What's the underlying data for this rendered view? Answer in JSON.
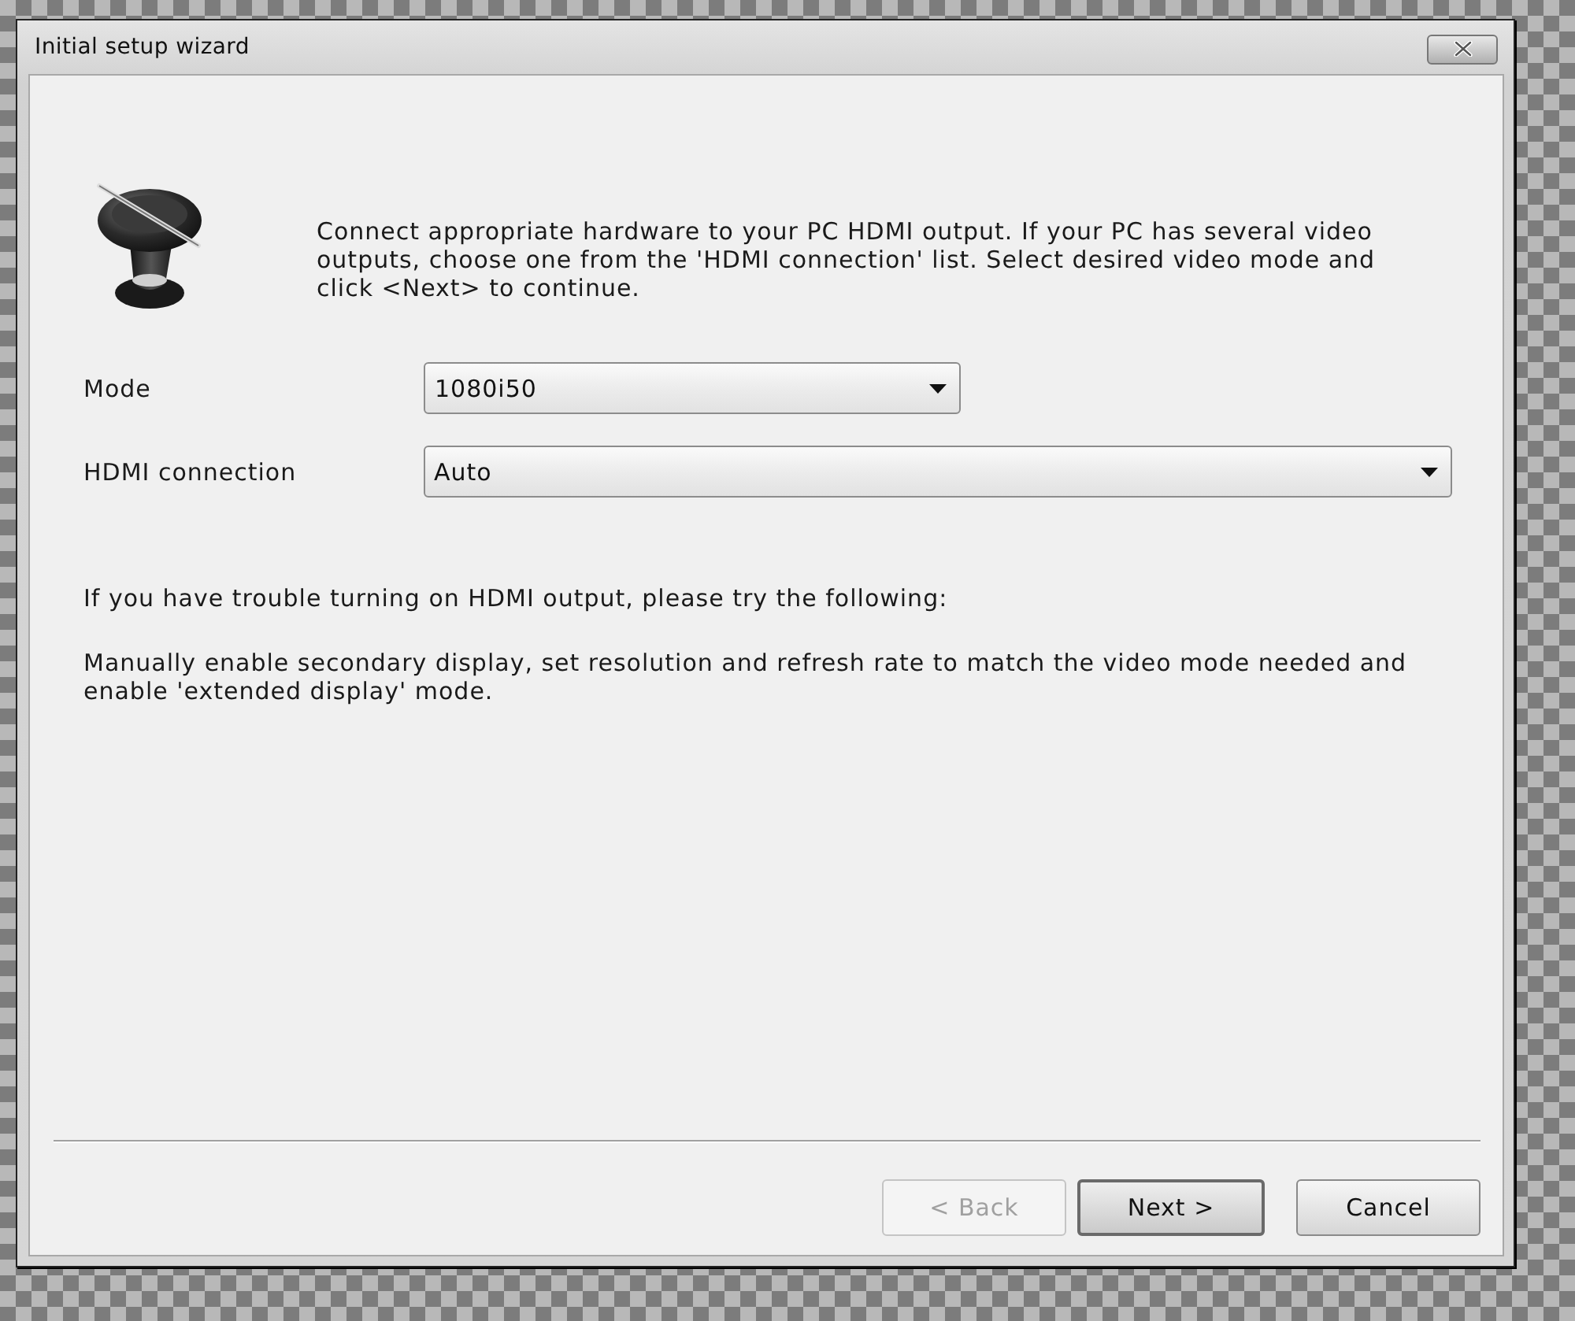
{
  "window": {
    "title": "Initial setup wizard"
  },
  "intro": {
    "text": "Connect appropriate hardware to your PC HDMI output. If your PC has several video outputs, choose one from the 'HDMI connection' list. Select desired video mode and click <Next> to continue."
  },
  "fields": [
    {
      "label": "Mode",
      "value": "1080i50"
    },
    {
      "label": "HDMI connection",
      "value": "Auto"
    }
  ],
  "notes": [
    "If you have trouble turning on HDMI output, please try the following:",
    "Manually enable secondary display, set resolution and refresh rate to match the video mode needed and enable 'extended display' mode."
  ],
  "buttons": [
    {
      "label": "< Back",
      "disabled": true,
      "default": false
    },
    {
      "label": "Next >",
      "disabled": false,
      "default": true
    },
    {
      "label": "Cancel",
      "disabled": false,
      "default": false
    }
  ]
}
